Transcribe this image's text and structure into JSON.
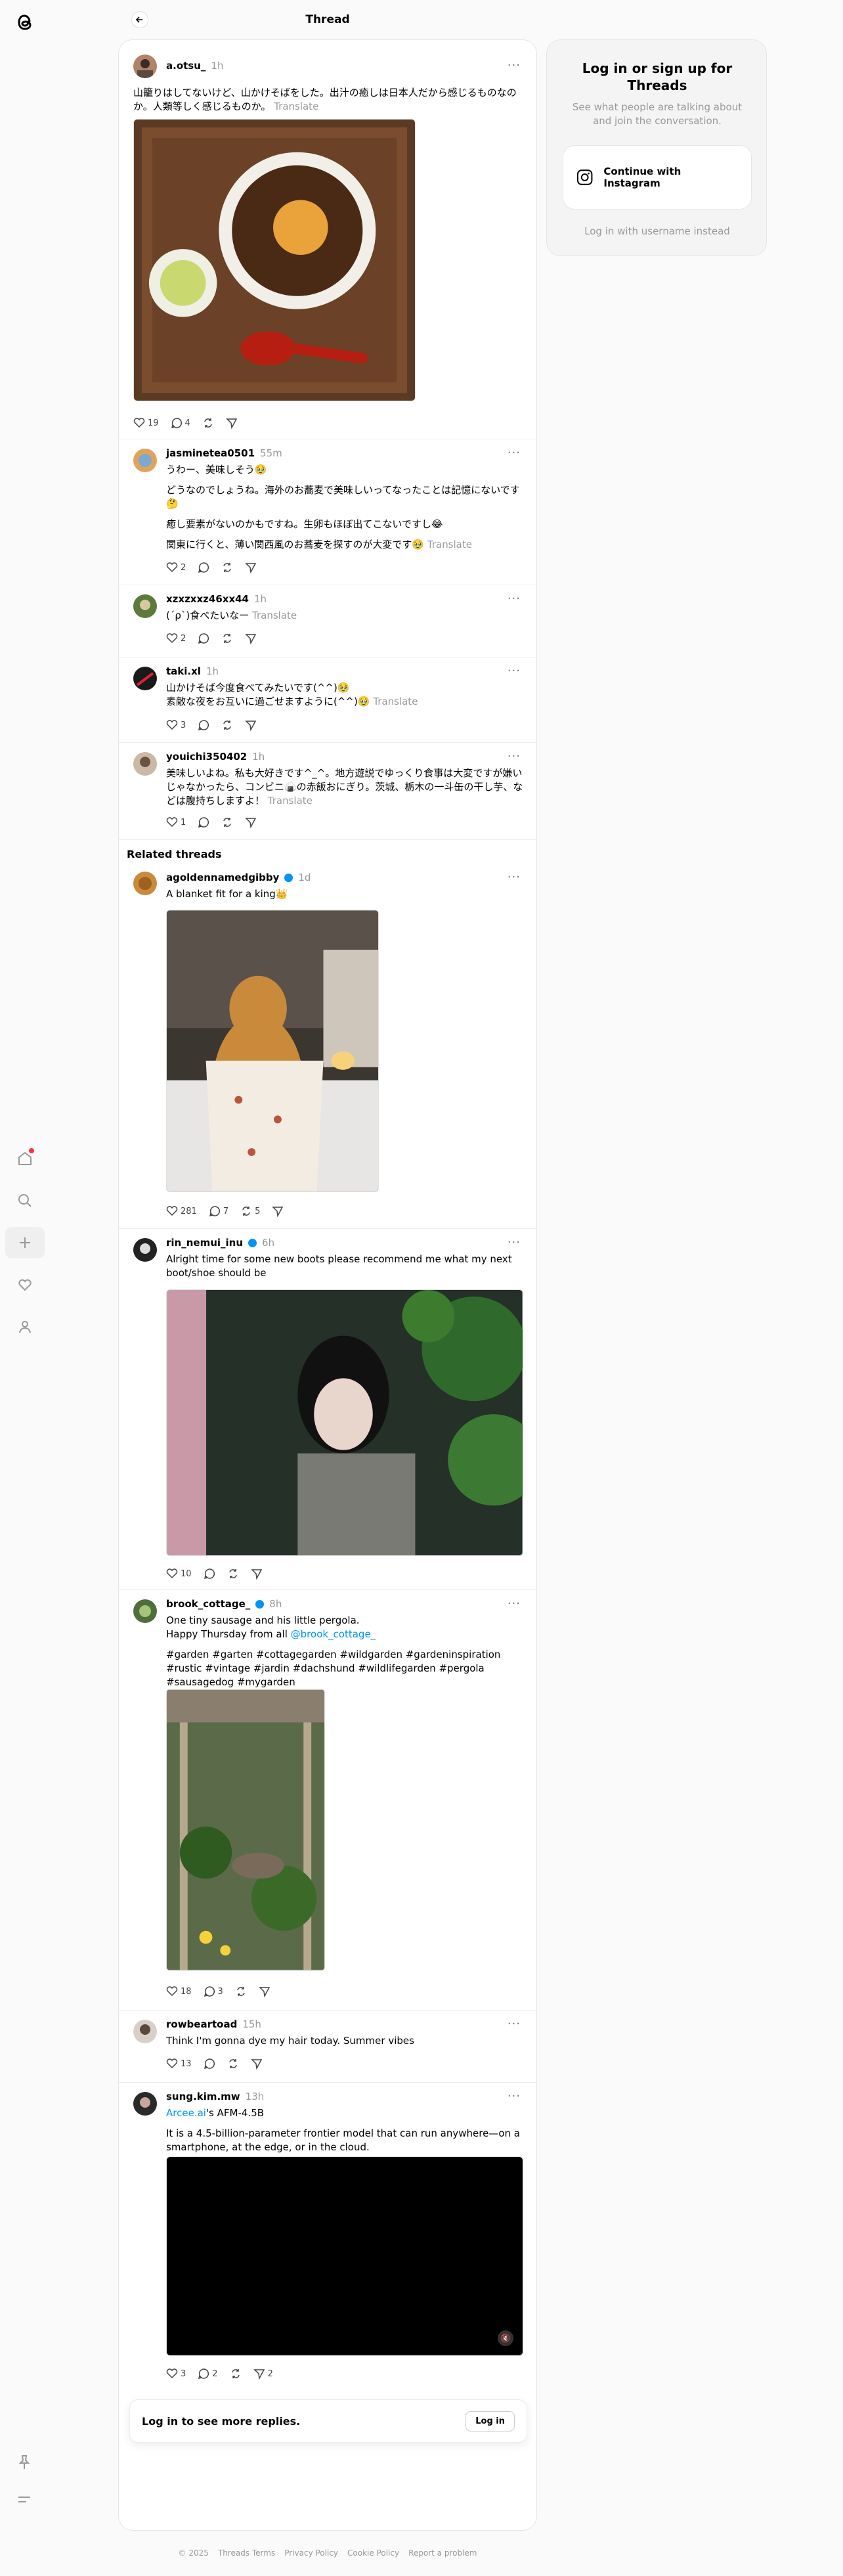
{
  "header": {
    "title": "Thread"
  },
  "main_post": {
    "username": "a.otsu_",
    "time": "1h",
    "text": "山籠りはしてないけど、山かけそばをした。出汁の癒しは日本人だから感じるものなのか。人類等しく感じるものか。",
    "translate": "Translate",
    "likes": "19",
    "replies": "4"
  },
  "replies": [
    {
      "username": "jasminetea0501",
      "time": "55m",
      "lines": [
        "うわー、美味しそう🥹",
        "どうなのでしょうね。海外のお蕎麦で美味しいってなったことは記憶にないです🤔",
        "癒し要素がないのかもですね。生卵もほぼ出てこないですし😂",
        "関東に行くと、薄い関西風のお蕎麦を探すのが大変です🥹"
      ],
      "translate": "Translate",
      "likes": "2"
    },
    {
      "username": "xzxzxxz46xx44",
      "time": "1h",
      "lines": [
        "(´ρ`)食べたいなー"
      ],
      "translate": "Translate",
      "likes": "2"
    },
    {
      "username": "taki.xl",
      "time": "1h",
      "lines": [
        "山かけそば今度食べてみたいです(^^)🥹",
        "素敵な夜をお互いに過ごせますように(^^)🥹"
      ],
      "translate": "Translate",
      "likes": "3"
    },
    {
      "username": "youichi350402",
      "time": "1h",
      "lines": [
        "美味しいよね。私も大好きです^_^。地方遊説でゆっくり食事は大変ですが嫌いじゃなかったら、コンビニ🍙の赤飯おにぎり。茨城、栃木の一斗缶の干し芋、などは腹持ちしますよ！"
      ],
      "translate": "Translate",
      "likes": "1"
    }
  ],
  "related": {
    "heading": "Related threads",
    "posts": [
      {
        "username": "agoldennamedgibby",
        "time": "1d",
        "lines": [
          "A blanket fit for a king👑"
        ],
        "likes": "281",
        "replies": "7",
        "reposts": "5"
      },
      {
        "username": "rin_nemui_inu",
        "time": "6h",
        "lines": [
          "Alright time for some new boots please recommend me what my next boot/shoe should be"
        ],
        "likes": "10"
      },
      {
        "username": "brook_cottage_",
        "time": "8h",
        "lines": [
          "One tiny sausage and his little pergola.",
          "Happy Thursday from all ",
          "#garden #garten #cottagegarden #wildgarden #gardeninspiration #rustic #vintage #jardin #dachshund #wildlifegarden #pergola #sausagedog #mygarden"
        ],
        "mention": "@brook_cottage_",
        "likes": "18",
        "replies": "3"
      },
      {
        "username": "rowbeartoad",
        "time": "15h",
        "lines": [
          "Think I'm gonna dye my hair today. Summer vibes"
        ],
        "likes": "13"
      },
      {
        "username": "sung.kim.mw",
        "time": "13h",
        "link": "Arcee.ai",
        "link_suffix": "'s AFM-4.5B",
        "lines": [
          "It is a 4.5-billion-parameter frontier model that can run anywhere—on a smartphone, at the edge, or in the cloud."
        ],
        "likes": "3",
        "replies": "2",
        "shares": "2"
      }
    ]
  },
  "login_bar": {
    "text": "Log in to see more replies.",
    "button": "Log in"
  },
  "login_card": {
    "title": "Log in or sign up for Threads",
    "subtitle": "See what people are talking about and join the conversation.",
    "instagram_button": "Continue with Instagram",
    "alt_login": "Log in with username instead"
  },
  "footer": {
    "copyright": "© 2025",
    "links": [
      "Threads Terms",
      "Privacy Policy",
      "Cookie Policy",
      "Report a problem"
    ]
  },
  "colors": {
    "accent": "#0095f6",
    "notification": "#ff3040"
  }
}
